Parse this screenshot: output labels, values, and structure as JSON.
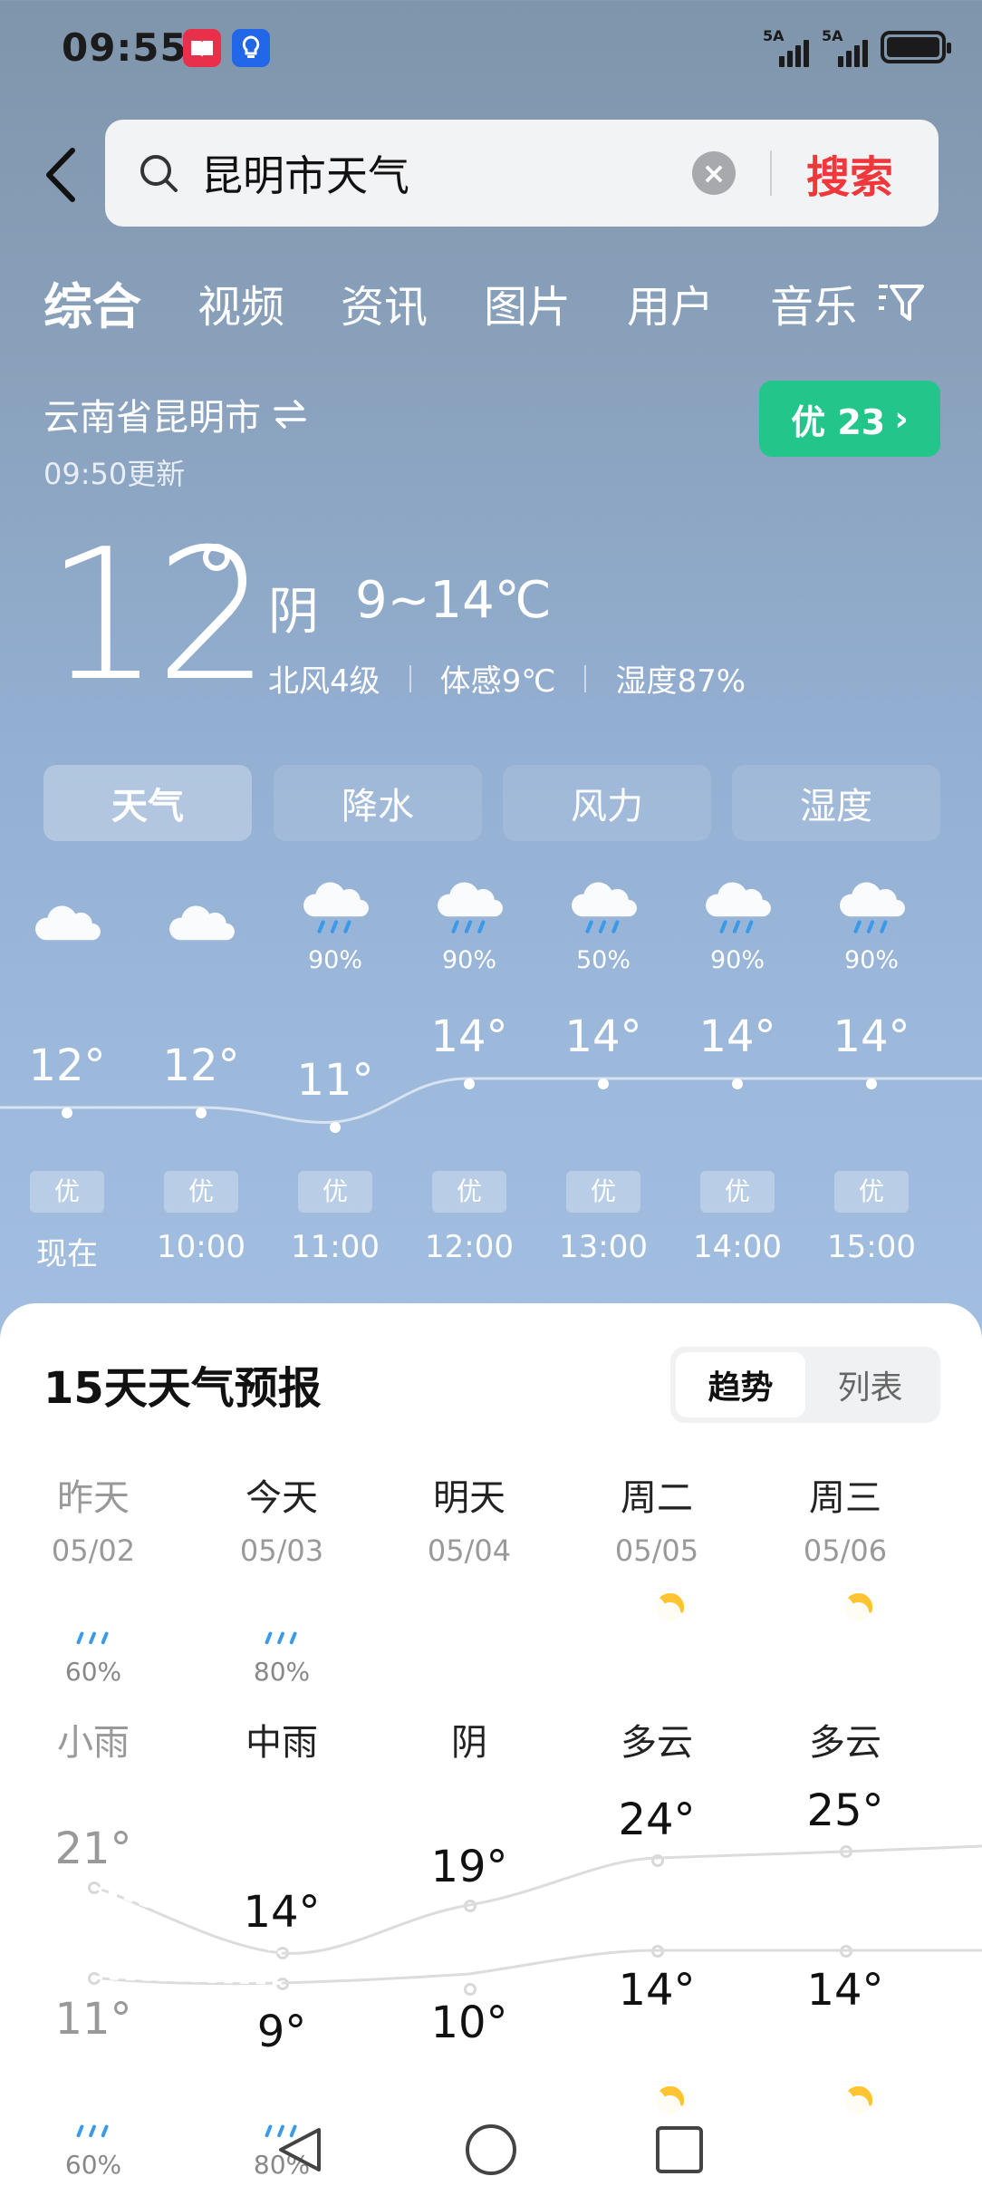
{
  "status": {
    "time": "09:55",
    "sim1": "5A",
    "sim2": "5A"
  },
  "search": {
    "query": "昆明市天气",
    "button": "搜索"
  },
  "tabs": [
    "综合",
    "视频",
    "资讯",
    "图片",
    "用户",
    "音乐"
  ],
  "location": {
    "name": "云南省昆明市",
    "updated": "09:50更新",
    "aqi": "优 23"
  },
  "current": {
    "temp": "12",
    "condition": "阴",
    "range": "9~14℃",
    "wind": "北风4级",
    "feels": "体感9℃",
    "humidity": "湿度87%"
  },
  "segments": [
    "天气",
    "降水",
    "风力",
    "湿度"
  ],
  "hourly": [
    {
      "time": "现在",
      "temp": "12°",
      "pct": "",
      "aq": "优",
      "icon": "cloud-icon"
    },
    {
      "time": "10:00",
      "temp": "12°",
      "pct": "",
      "aq": "优",
      "icon": "cloud-icon"
    },
    {
      "time": "11:00",
      "temp": "11°",
      "pct": "90%",
      "aq": "优",
      "icon": "rain-cloud-icon"
    },
    {
      "time": "12:00",
      "temp": "14°",
      "pct": "90%",
      "aq": "优",
      "icon": "rain-cloud-icon"
    },
    {
      "time": "13:00",
      "temp": "14°",
      "pct": "50%",
      "aq": "优",
      "icon": "rain-cloud-icon"
    },
    {
      "time": "14:00",
      "temp": "14°",
      "pct": "90%",
      "aq": "优",
      "icon": "rain-cloud-icon"
    },
    {
      "time": "15:00",
      "temp": "14°",
      "pct": "90%",
      "aq": "优",
      "icon": "rain-cloud-icon"
    }
  ],
  "forecast": {
    "title": "15天天气预报",
    "toggle": [
      "趋势",
      "列表"
    ],
    "days": [
      {
        "name": "昨天",
        "date": "05/02",
        "pct": "60%",
        "cond": "小雨",
        "high": "21°",
        "low": "11°",
        "night_pct": "60%",
        "icon": "light-rain-icon"
      },
      {
        "name": "今天",
        "date": "05/03",
        "pct": "80%",
        "cond": "中雨",
        "high": "14°",
        "low": "9°",
        "night_pct": "80%",
        "icon": "moderate-rain-icon"
      },
      {
        "name": "明天",
        "date": "05/04",
        "pct": "",
        "cond": "阴",
        "high": "19°",
        "low": "10°",
        "night_pct": "",
        "icon": "overcast-icon"
      },
      {
        "name": "周二",
        "date": "05/05",
        "pct": "",
        "cond": "多云",
        "high": "24°",
        "low": "14°",
        "night_pct": "",
        "icon": "partly-cloudy-icon"
      },
      {
        "name": "周三",
        "date": "05/06",
        "pct": "",
        "cond": "多云",
        "high": "25°",
        "low": "14°",
        "night_pct": "",
        "icon": "partly-cloudy-icon"
      }
    ]
  }
}
